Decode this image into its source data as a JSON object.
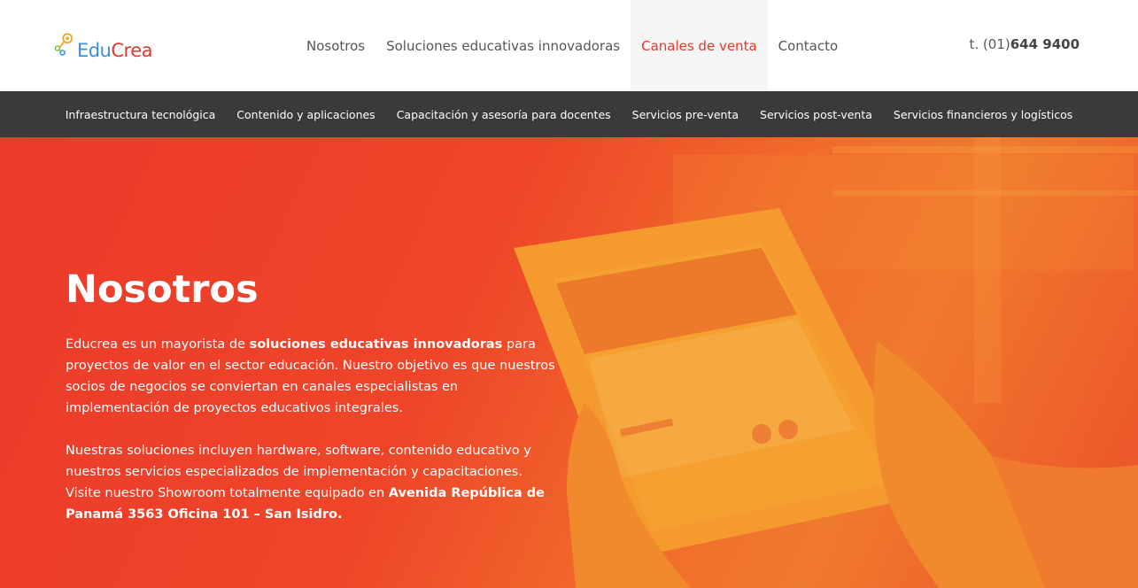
{
  "brand": {
    "name_part1": "Edu",
    "name_part2": "Crea",
    "colors": {
      "edu": "#3b8fd9",
      "crea": "#e2372b"
    }
  },
  "nav": {
    "items": [
      {
        "label": "Nosotros",
        "active": false
      },
      {
        "label": "Soluciones educativas innovadoras",
        "active": false
      },
      {
        "label": "Canales de venta",
        "active": true
      },
      {
        "label": "Contacto",
        "active": false
      }
    ]
  },
  "phone": {
    "prefix": "t. (01)",
    "number": "644 9400"
  },
  "subnav": {
    "items": [
      "Infraestructura tecnológica",
      "Contenido y aplicaciones",
      "Capacitación y asesoría para docentes",
      "Servicios pre-venta",
      "Servicios post-venta",
      "Servicios financieros y logísticos"
    ]
  },
  "hero": {
    "title": "Nosotros",
    "p1_a": "Educrea es un mayorista de ",
    "p1_b": "soluciones educativas innovadoras",
    "p1_c": " para proyectos de valor en el sector educación. Nuestro objetivo es que nuestros socios de negocios se conviertan en canales especialistas en implementación de proyectos educativos integrales.",
    "p2_a": "Nuestras soluciones incluyen hardware, software, contenido educativo y nuestros servicios especializados de implementación y capacitaciones. Visite nuestro Showroom totalmente equipado en ",
    "p2_b": "Avenida República de Panamá 3563 Oficina 101 – San Isidro.",
    "accent_color": "#ec3a2a"
  }
}
